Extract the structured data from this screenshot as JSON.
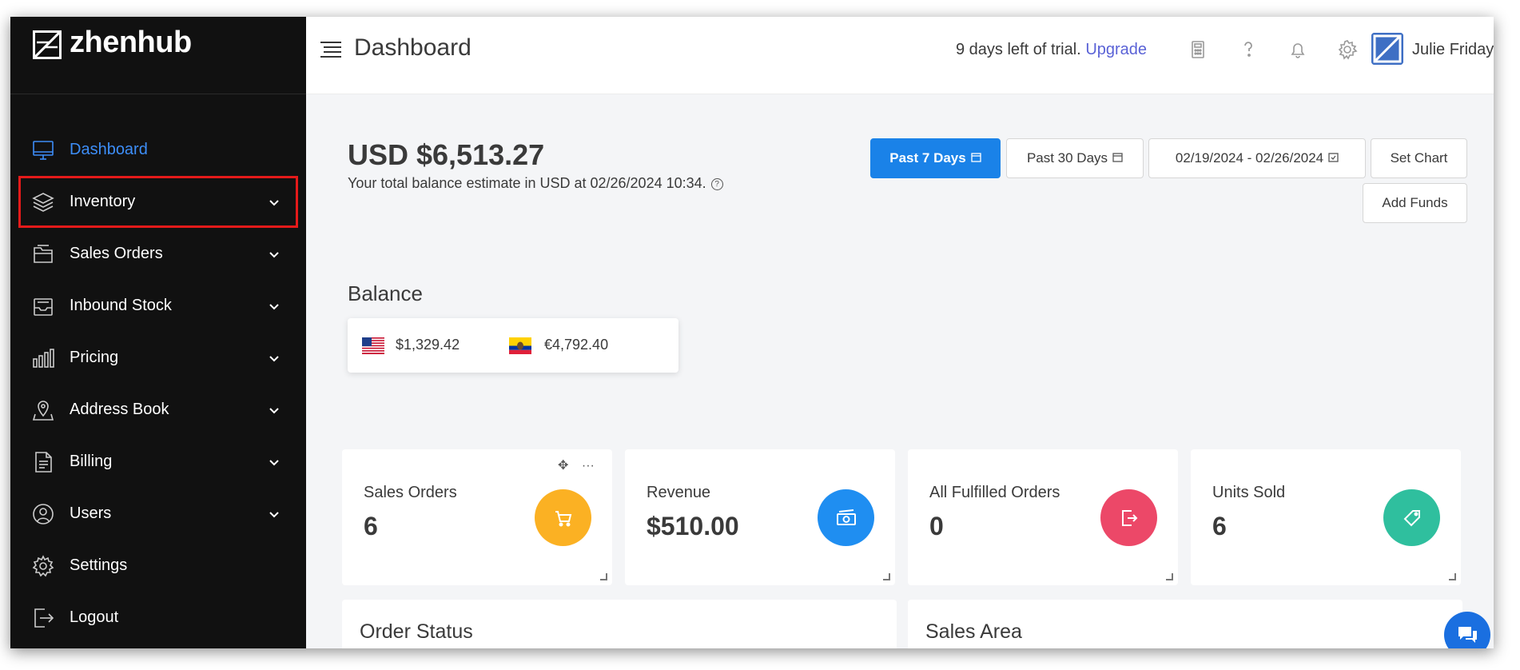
{
  "brand": {
    "name": "zhenhub"
  },
  "sidebar": {
    "items": [
      {
        "label": "Dashboard",
        "icon": "monitor-icon",
        "active": true,
        "expandable": false
      },
      {
        "label": "Inventory",
        "icon": "layers-icon",
        "active": false,
        "expandable": true,
        "highlighted": true
      },
      {
        "label": "Sales Orders",
        "icon": "folder-icon",
        "active": false,
        "expandable": true
      },
      {
        "label": "Inbound Stock",
        "icon": "inbox-icon",
        "active": false,
        "expandable": true
      },
      {
        "label": "Pricing",
        "icon": "bar-chart-icon",
        "active": false,
        "expandable": true
      },
      {
        "label": "Address Book",
        "icon": "map-pin-icon",
        "active": false,
        "expandable": true
      },
      {
        "label": "Billing",
        "icon": "document-icon",
        "active": false,
        "expandable": true
      },
      {
        "label": "Users",
        "icon": "globe-user-icon",
        "active": false,
        "expandable": true
      },
      {
        "label": "Settings",
        "icon": "gear-icon",
        "active": false,
        "expandable": false
      },
      {
        "label": "Logout",
        "icon": "logout-icon",
        "active": false,
        "expandable": false
      }
    ]
  },
  "header": {
    "title": "Dashboard",
    "trial_text": "9 days left of trial.",
    "upgrade_label": "Upgrade",
    "user_name": "Julie Friday",
    "icons": [
      "calculator-icon",
      "help-icon",
      "bell-icon",
      "gear-icon"
    ]
  },
  "summary": {
    "balance_amount": "USD $6,513.27",
    "balance_subtitle": "Your total balance estimate in USD at 02/26/2024 10:34.",
    "help_glyph": "?"
  },
  "filters": {
    "past7": "Past 7 Days",
    "past30": "Past 30 Days",
    "date_range": "02/19/2024 - 02/26/2024",
    "set_chart": "Set Chart",
    "add_funds": "Add Funds"
  },
  "balance": {
    "title": "Balance",
    "items": [
      {
        "flag": "us-flag-icon",
        "value": "$1,329.42"
      },
      {
        "flag": "ecuador-flag-icon",
        "value": "€4,792.40"
      }
    ]
  },
  "stats": [
    {
      "label": "Sales Orders",
      "value": "6",
      "color": "#fbb123",
      "icon": "cart-icon"
    },
    {
      "label": "Revenue",
      "value": "$510.00",
      "color": "#1f8ef1",
      "icon": "cash-icon"
    },
    {
      "label": "All Fulfilled Orders",
      "value": "0",
      "color": "#ec4868",
      "icon": "exit-icon"
    },
    {
      "label": "Units Sold",
      "value": "6",
      "color": "#2fbf9e",
      "icon": "tag-icon"
    }
  ],
  "panels": {
    "order_status": "Order Status",
    "sales_area": "Sales Area"
  },
  "colors": {
    "sidebar_bg": "#111111",
    "active_nav": "#3d8ef8",
    "primary": "#1a82e8",
    "highlight": "#e41a1a"
  }
}
